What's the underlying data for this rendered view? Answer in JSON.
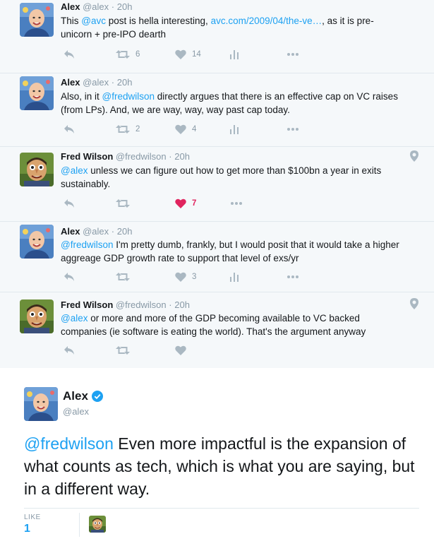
{
  "colors": {
    "link": "#1da1f2",
    "muted": "#8899a6",
    "like_active": "#e0245e",
    "icon": "#aab8c2"
  },
  "tweets": [
    {
      "name": "Alex",
      "handle": "@alex",
      "sep": "·",
      "time": "20h",
      "text_parts": [
        "This ",
        "@avc",
        " post is hella interesting, ",
        "avc.com/2009/04/the-ve…",
        ", as it is pre-unicorn + pre-IPO dearth"
      ],
      "retweets": "6",
      "likes": "14",
      "liked": false,
      "pin": false,
      "analytics": true
    },
    {
      "name": "Alex",
      "handle": "@alex",
      "sep": "·",
      "time": "20h",
      "text_parts": [
        "Also, in it ",
        "@fredwilson",
        " directly argues that there is an effective cap on VC raises (from LPs). And, we are way, way, way past cap today."
      ],
      "retweets": "2",
      "likes": "4",
      "liked": false,
      "pin": false,
      "analytics": true
    },
    {
      "name": "Fred Wilson",
      "handle": "@fredwilson",
      "sep": "·",
      "time": "20h",
      "text_parts": [
        "@alex",
        " unless we can figure out how to get more than $100bn a year in exits sustainably."
      ],
      "retweets": "",
      "likes": "7",
      "liked": true,
      "pin": true,
      "analytics": false
    },
    {
      "name": "Alex",
      "handle": "@alex",
      "sep": "·",
      "time": "20h",
      "text_parts": [
        "@fredwilson",
        " I'm pretty dumb, frankly, but I would posit that it would take a higher aggreage GDP growth rate to support that level of exs/yr"
      ],
      "retweets": "",
      "likes": "3",
      "liked": false,
      "pin": false,
      "analytics": true
    },
    {
      "name": "Fred Wilson",
      "handle": "@fredwilson",
      "sep": "·",
      "time": "20h",
      "text_parts": [
        "@alex",
        " or more and more of the GDP becoming available to VC backed companies (ie software is eating the world). That's the argument anyway"
      ],
      "retweets": "",
      "likes": "",
      "liked": false,
      "pin": true,
      "analytics": false
    }
  ],
  "main_tweet": {
    "name": "Alex",
    "handle": "@alex",
    "mention": "@fredwilson",
    "text": " Even more impactful is the expansion of what counts as tech, which is what you are saying, but in a different way.",
    "likes_label": "LIKE",
    "likes_count": "1"
  },
  "icons": [
    "reply-icon",
    "retweet-icon",
    "like-icon",
    "analytics-icon",
    "more-icon",
    "location-pin-icon",
    "verified-badge-icon"
  ]
}
